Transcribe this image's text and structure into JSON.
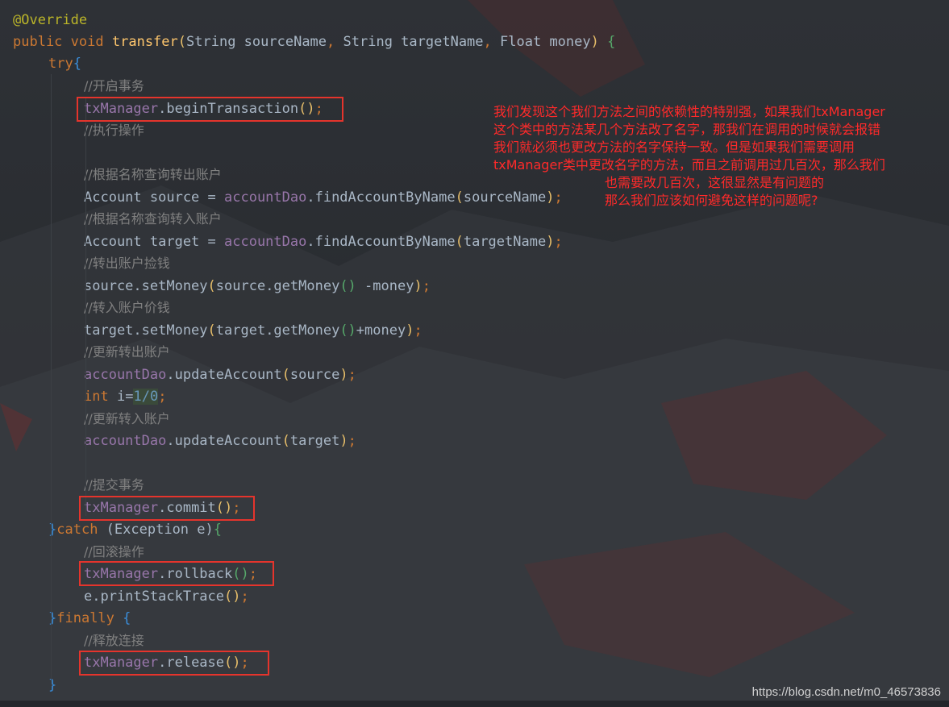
{
  "code": {
    "annotation": "@Override",
    "l1": {
      "kw1": "public",
      "kw2": "void",
      "fn": "transfer",
      "p1": "(",
      "t1": "String",
      "n1": " sourceName",
      "c1": ", ",
      "t2": "String",
      "n2": " targetName",
      "c2": ", ",
      "t3": "Float",
      "n3": " money",
      "p2": ")",
      "sp": " ",
      "b": "{"
    },
    "try_kw": "try",
    "try_b": "{",
    "c_begin": "//开启事务",
    "begin": {
      "obj": "txManager",
      "m": ".beginTransaction",
      "p": "()",
      "s": ";"
    },
    "c_exec": "//执行操作",
    "c_find_src": "//根据名称查询转出账户",
    "src": {
      "t": "Account source = ",
      "obj": "accountDao",
      "m": ".findAccountByName",
      "p1": "(",
      "a": "sourceName",
      "p2": ")",
      "s": ";"
    },
    "c_find_tgt": "//根据名称查询转入账户",
    "tgt": {
      "t": "Account target = ",
      "obj": "accountDao",
      "m": ".findAccountByName",
      "p1": "(",
      "a": "targetName",
      "p2": ")",
      "s": ";"
    },
    "c_sub": "//转出账户捡钱",
    "sub": {
      "a": "source.setMoney",
      "p1": "(",
      "b": "source.getMoney",
      "p2": "()",
      "c": " -money",
      "p3": ")",
      "s": ";"
    },
    "c_add": "//转入账户价钱",
    "add": {
      "a": "target.setMoney",
      "p1": "(",
      "b": "target.getMoney",
      "p2": "()",
      "c": "+money",
      "p3": ")",
      "s": ";"
    },
    "c_upd_src": "//更新转出账户",
    "upd_src": {
      "obj": "accountDao",
      "m": ".updateAccount",
      "p1": "(",
      "a": "source",
      "p2": ")",
      "s": ";"
    },
    "div": {
      "kw": "int",
      "v": " i=",
      "n1": "1",
      "op": "/",
      "n2": "0",
      "s": ";"
    },
    "c_upd_tgt": "//更新转入账户",
    "upd_tgt": {
      "obj": "accountDao",
      "m": ".updateAccount",
      "p1": "(",
      "a": "target",
      "p2": ")",
      "s": ";"
    },
    "c_commit": "//提交事务",
    "commit": {
      "obj": "txManager",
      "m": ".commit",
      "p": "()",
      "s": ";"
    },
    "catch": {
      "b1": "}",
      "kw": "catch",
      "p1": " (",
      "t": "Exception e",
      "p2": ")",
      "b2": "{"
    },
    "c_rollback": "//回滚操作",
    "rollback": {
      "obj": "txManager",
      "m": ".rollback",
      "p": "()",
      "s": ";"
    },
    "trace": {
      "a": "e.printStackTrace",
      "p": "()",
      "s": ";"
    },
    "finally": {
      "b1": "}",
      "kw": "finally",
      "sp": " ",
      "b2": "{"
    },
    "c_release": "//释放连接",
    "release": {
      "obj": "txManager",
      "m": ".release",
      "p": "()",
      "s": ";"
    },
    "close": "}"
  },
  "note": {
    "l1": "我们发现这个我们方法之间的依赖性的特别强，如果我们txManager",
    "l2": "这个类中的方法某几个方法改了名字，那我们在调用的时候就会报错",
    "l3": "我们就必须也更改方法的名字保持一致。但是如果我们需要调用",
    "l4": "txManager类中更改名字的方法，而且之前调用过几百次，那么我们",
    "l5": "也需要改几百次，这很显然是有问题的",
    "l6": "那么我们应该如何避免这样的问题呢?"
  },
  "watermark": "https://blog.csdn.net/m0_46573836",
  "colors": {
    "keyword": "#cc7832",
    "method": "#ffc66d",
    "field": "#9876aa",
    "comment": "#808080",
    "highlight_box": "#e5342c",
    "note_text": "#ff2a2a"
  }
}
